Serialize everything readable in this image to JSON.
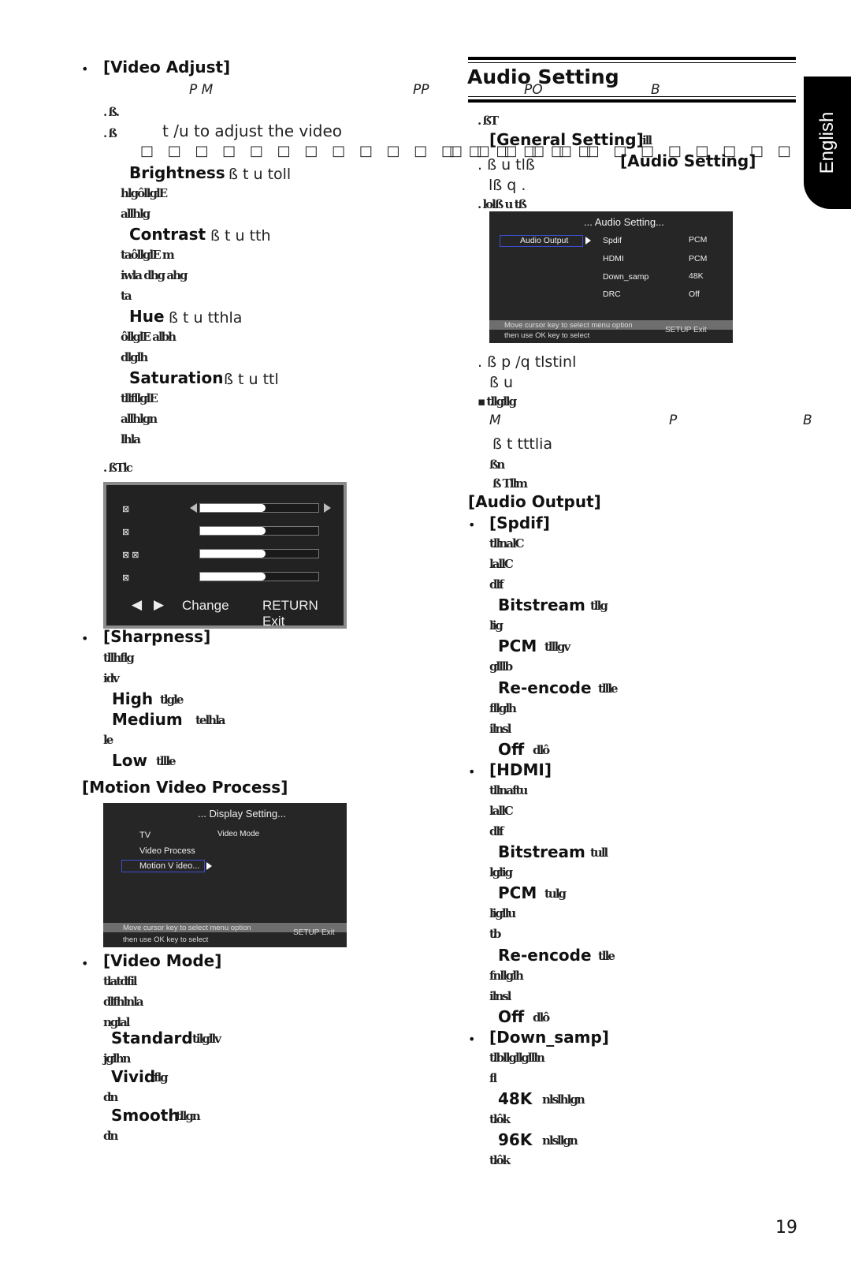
{
  "language_tab": "English",
  "page_number": "19",
  "left": {
    "video_adjust": {
      "heading": "[Video Adjust]",
      "italic_line": [
        "P M",
        "PP"
      ],
      "step1_marker": ". ",
      "step1_text": "ß.",
      "step2_text": "t /u  to adjust the video",
      "boxes_line": "□ □ □ □ □ □ □ □ □ □       □ □ □ □ □ □ □",
      "items": [
        {
          "label": "Brightness",
          "tail": "ß            t   u   toll",
          "lines": [
            "hlgôllglE",
            "allhlg"
          ]
        },
        {
          "label": "Contrast",
          "tail": "ß            t   u   tth",
          "lines": [
            "taôllglE m",
            "iwla dhg ahg",
            "ta"
          ]
        },
        {
          "label": "Hue",
          "tail": "ß            t   u   tthla",
          "lines": [
            "ôllglE albh",
            "dlglh"
          ]
        },
        {
          "label": "Saturation",
          "tail": "ß            t   u   ttl",
          "lines": [
            "tllfllglE",
            "allhlgn",
            "lhla"
          ]
        }
      ],
      "step3_text": "ßTlc",
      "screen": {
        "rows": [
          {
            "label": "⊠",
            "value": 0.55,
            "selected": true
          },
          {
            "label": "⊠",
            "value": 0.55,
            "selected": false
          },
          {
            "label": "⊠  ⊠",
            "value": 0.55,
            "selected": false
          },
          {
            "label": "⊠",
            "value": 0.55,
            "selected": false
          }
        ],
        "nav_change": "Change",
        "nav_return": "RETURN",
        "nav_exit": "Exit"
      }
    },
    "sharpness": {
      "heading": "[Sharpness]",
      "lines": [
        "tllhflg",
        "idv"
      ],
      "options": [
        {
          "label": "High",
          "desc": "tlgle"
        },
        {
          "label": "Medium",
          "desc": "telhla",
          "extra": "le"
        },
        {
          "label": "Low",
          "desc": "tllle"
        }
      ]
    },
    "motion_video": {
      "heading": "[Motion Video Process]",
      "screen": {
        "title": "... Display Setting...",
        "menu": [
          "TV",
          "Video Process",
          "Motion V ideo..."
        ],
        "selected_index": 2,
        "right_label": "Video Mode",
        "footer_line1": "Move cursor key to select menu option",
        "footer_line2": "then use  OK  key to select",
        "footer_right": "SETUP  Exit"
      }
    },
    "video_mode": {
      "heading": "[Video Mode]",
      "lines": [
        "tlatdfil",
        "dlfhlnla",
        "nglal"
      ],
      "options": [
        {
          "label": "Standard",
          "desc": "tilgllv",
          "extra": "jglhn"
        },
        {
          "label": "Vivid",
          "desc": "flg",
          "extra": "dn"
        },
        {
          "label": "Smooth",
          "desc": "tllgn",
          "extra": "dn"
        }
      ]
    }
  },
  "right": {
    "audio_setting": {
      "title": "Audio Setting",
      "subtitle_italic": [
        "PO",
        "B"
      ],
      "steps": [
        {
          "marker": ". ",
          "text": "ßT"
        },
        {
          "marker": "",
          "text": "[General Setting]",
          "tail": "ill",
          "bold": true
        },
        {
          "marker": ". ",
          "text": "ß        u   tlß",
          "bold_tail": "[Audio Setting]"
        },
        {
          "marker": "",
          "text": "lß                q  ."
        },
        {
          "marker": ". ",
          "text": "lolß                                          u   tß"
        }
      ],
      "boxes_line": "□ □          □ □   □ □ □        □ □ □ □ □ □ □ □ □",
      "screen": {
        "title": "... Audio Setting...",
        "left_item": "Audio Output",
        "rows": [
          {
            "name": "Spdif",
            "value": "PCM"
          },
          {
            "name": "HDMI",
            "value": "PCM"
          },
          {
            "name": "Down_samp",
            "value": "48K"
          },
          {
            "name": "DRC",
            "value": "Off"
          }
        ],
        "footer_line1": "Move cursor key to select menu option",
        "footer_line2": "then use  OK  key to select",
        "footer_right": "SETUP  Exit"
      },
      "after": [
        ". ß        p /q  tlstinl",
        "ß          u",
        "▪ tllgllg",
        "ß         t   tttlia",
        "ßn",
        "ß          Tllm"
      ],
      "italic_line": [
        "M",
        "P",
        "B"
      ]
    },
    "audio_output": {
      "heading": "[Audio Output]",
      "spdif": {
        "heading": "[Spdif]",
        "lines": [
          "tllnalC",
          "lallC",
          "dlf"
        ],
        "options": [
          {
            "label": "Bitstream",
            "desc": "tllg",
            "extra": [
              "lig"
            ]
          },
          {
            "label": "PCM",
            "desc": "tlllgv",
            "extra": [
              "glllb"
            ]
          },
          {
            "label": "Re-encode",
            "desc": "tllle",
            "extra": [
              "fllglh",
              "ilnsl"
            ]
          },
          {
            "label": "Off",
            "desc": "dlô",
            "extra": []
          }
        ]
      },
      "hdmi": {
        "heading": "[HDMI]",
        "lines": [
          "tllnaftu",
          "lallC",
          "dlf"
        ],
        "options": [
          {
            "label": "Bitstream",
            "desc": "tull",
            "extra": [
              "lglig"
            ]
          },
          {
            "label": "PCM",
            "desc": "tulg",
            "extra": [
              "ligllu",
              "tb"
            ]
          },
          {
            "label": "Re-encode",
            "desc": "tlle",
            "extra": [
              "fnllglh",
              "ilnsl"
            ]
          },
          {
            "label": "Off",
            "desc": "dlô",
            "extra": []
          }
        ]
      },
      "down_samp": {
        "heading": "[Down_samp]",
        "lines": [
          "tlbllgllgllln",
          "fl"
        ],
        "options": [
          {
            "label": "48K",
            "desc": "nlslhlgn",
            "extra": [
              "tlôk"
            ]
          },
          {
            "label": "96K",
            "desc": "nlsllgn",
            "extra": [
              "tlôk"
            ]
          }
        ]
      }
    }
  }
}
